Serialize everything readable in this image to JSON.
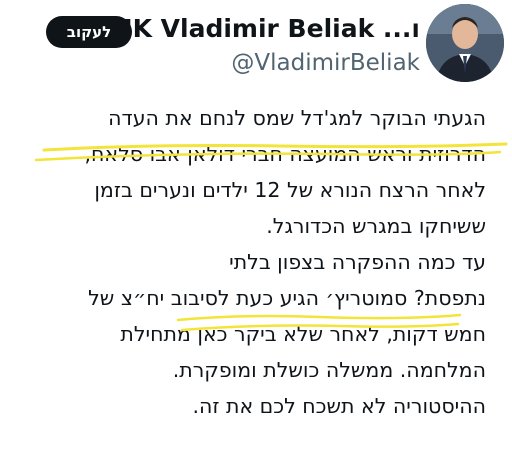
{
  "header": {
    "display_name": "MK Vladimir Beliak ...ו",
    "handle": "@VladimirBeliak",
    "follow_label": "לעקוב",
    "verified_icon": "verified-badge-icon",
    "verified_color": "#1d9bf0"
  },
  "tweet": {
    "lines": [
      "הגעתי הבוקר למג'דל שמס לנחם את העדה",
      "הדרוזית וראש המועצה חברי דולאן אבו סלאח,",
      "לאחר הרצח הנורא של 12 ילדים ונערים בזמן",
      "ששיחקו במגרש הכדורגל.",
      "עד כמה ההפקרה בצפון בלתי",
      "נתפסת? סמוטריץ׳ הגיע כעת לסיבוב יח״צ של",
      "חמש דקות, לאחר שלא ביקר כאן מתחילת",
      "המלחמה. ממשלה כושלת ומופקרת.",
      "ההיסטוריה לא תשכח לכם את זה."
    ],
    "highlight_color": "#f3e43a"
  }
}
